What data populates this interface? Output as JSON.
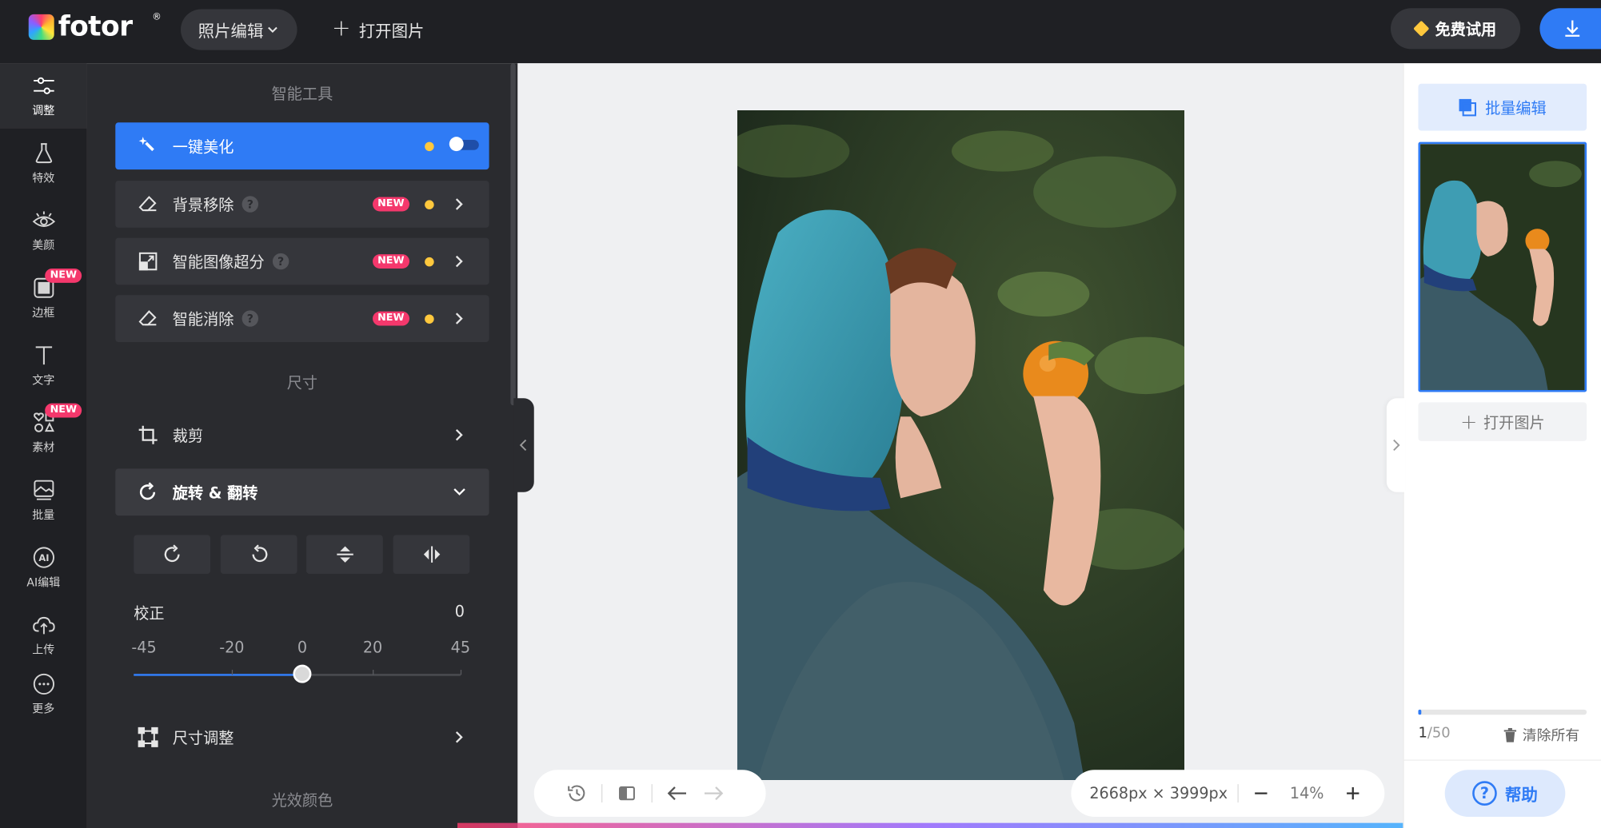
{
  "app": {
    "logo_text": "fotor",
    "logo_reg": "®",
    "mode_label": "照片编辑",
    "open_image_label": "打开图片",
    "free_trial_label": "免费试用"
  },
  "rail": {
    "items": [
      {
        "label": "调整",
        "icon": "sliders-icon"
      },
      {
        "label": "特效",
        "icon": "flask-icon"
      },
      {
        "label": "美颜",
        "icon": "eye-icon"
      },
      {
        "label": "边框",
        "icon": "frame-icon",
        "badge": "NEW"
      },
      {
        "label": "文字",
        "icon": "text-icon"
      },
      {
        "label": "素材",
        "icon": "elements-icon",
        "badge": "NEW"
      },
      {
        "label": "批量",
        "icon": "batch-icon"
      },
      {
        "label": "AI编辑",
        "icon": "ai-icon"
      },
      {
        "label": "上传",
        "icon": "upload-icon"
      },
      {
        "label": "更多",
        "icon": "more-icon"
      }
    ]
  },
  "panel": {
    "smart_tools_title": "智能工具",
    "tools": [
      {
        "label": "一键美化",
        "state": "active",
        "toggle": true
      },
      {
        "label": "背景移除",
        "badge": "NEW",
        "help": "?"
      },
      {
        "label": "智能图像超分",
        "badge": "NEW",
        "help": "?"
      },
      {
        "label": "智能消除",
        "badge": "NEW",
        "help": "?"
      }
    ],
    "size_title": "尺寸",
    "crop_label": "裁剪",
    "rotate_label": "旋转 & 翻转",
    "straighten_label": "校正",
    "straighten_value": "0",
    "slider": {
      "ticks": [
        "-45",
        "-20",
        "0",
        "20",
        "45"
      ],
      "min": -45,
      "max": 45,
      "value": 0
    },
    "resize_label": "尺寸调整",
    "light_color_title": "光效颜色"
  },
  "canvas": {
    "dimensions_text": "2668px × 3999px",
    "zoom_text": "14%"
  },
  "right_panel": {
    "batch_edit_label": "批量编辑",
    "open_image_label": "打开图片",
    "count_current": "1",
    "count_total": "/50",
    "progress_fraction": 0.02,
    "clear_all_label": "清除所有",
    "help_label": "帮助",
    "help_icon_text": "?"
  },
  "colors": {
    "accent": "#2f7bf5",
    "new_badge": "#f4386c",
    "dark_bg": "#1f2024",
    "panel_bg": "#2a2b2f"
  }
}
